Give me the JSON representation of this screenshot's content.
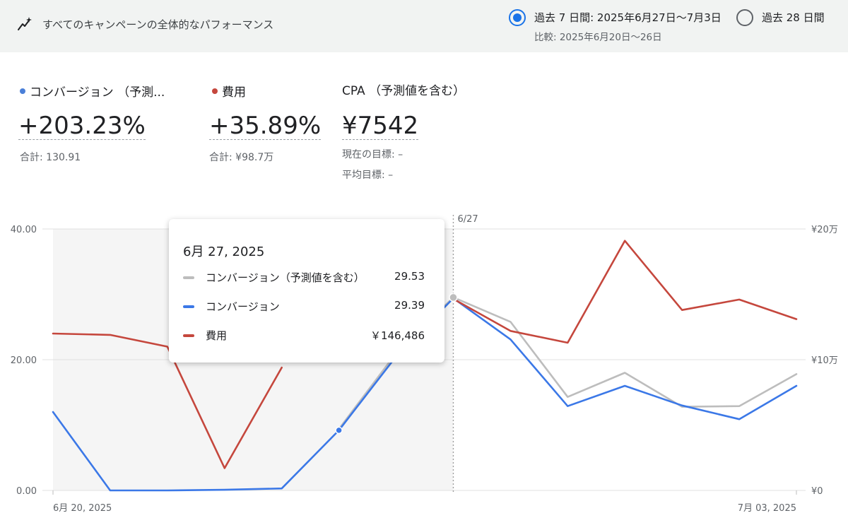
{
  "header": {
    "title": "すべてのキャンペーンの全体的なパフォーマンス",
    "range_selected": "過去 7 日間: 2025年6月27日〜7月3日",
    "range_compare": "比較: 2025年6月20日〜26日",
    "range_other": "過去 28 日間"
  },
  "metrics": [
    {
      "label": "コンバージョン （予測...",
      "value": "+203.23%",
      "sub": "合計: 130.91",
      "dot": "#4a7fd8"
    },
    {
      "label": "費用",
      "value": "+35.89%",
      "sub": "合計: ¥98.7万",
      "dot": "#c5473d"
    },
    {
      "label": "CPA （予測値を含む）",
      "value": "¥7542",
      "sub1": "現在の目標: –",
      "sub2": "平均目標: –"
    }
  ],
  "tooltip": {
    "date": "6月 27, 2025",
    "rows": [
      {
        "name": "コンバージョン（予測値を含む）",
        "value": "29.53",
        "color": "#bdbdbd"
      },
      {
        "name": "コンバージョン",
        "value": "29.39",
        "color": "#3b78e7"
      },
      {
        "name": "費用",
        "value": "￥146,486",
        "color": "#c5473d"
      }
    ]
  },
  "chart_data": {
    "type": "line",
    "x": [
      "6/20",
      "6/21",
      "6/22",
      "6/23",
      "6/24",
      "6/25",
      "6/26",
      "6/27",
      "6/28",
      "6/29",
      "6/30",
      "7/01",
      "7/02",
      "7/03"
    ],
    "x_tick_labels": [
      "6月 20, 2025",
      "7月 03, 2025"
    ],
    "divider_label": "6/27",
    "y_left": {
      "ticks": [
        "40.00",
        "20.00",
        "0.00"
      ],
      "range": [
        0,
        40
      ]
    },
    "y_right": {
      "ticks": [
        "¥20万",
        "¥10万",
        "¥0"
      ],
      "range": [
        0,
        200000
      ]
    },
    "series": [
      {
        "name": "コンバージョン（予測値を含む）",
        "axis": "left",
        "color": "#bdbdbd",
        "values": [
          null,
          null,
          null,
          null,
          null,
          9.4,
          21.0,
          29.53,
          25.8,
          14.3,
          18.0,
          12.8,
          12.9,
          17.8
        ]
      },
      {
        "name": "コンバージョン",
        "axis": "left",
        "color": "#3b78e7",
        "values": [
          12.0,
          0.0,
          0.0,
          0.1,
          0.3,
          9.2,
          20.5,
          29.39,
          23.1,
          12.9,
          16.0,
          13.0,
          10.9,
          16.0
        ]
      },
      {
        "name": "費用",
        "axis": "right",
        "color": "#c5473d",
        "values": [
          120000,
          119000,
          110000,
          17000,
          94000,
          null,
          null,
          146486,
          122000,
          113000,
          191000,
          138000,
          146000,
          131000
        ]
      }
    ],
    "shaded_range": [
      "6/20",
      "6/27"
    ],
    "grid": true
  }
}
